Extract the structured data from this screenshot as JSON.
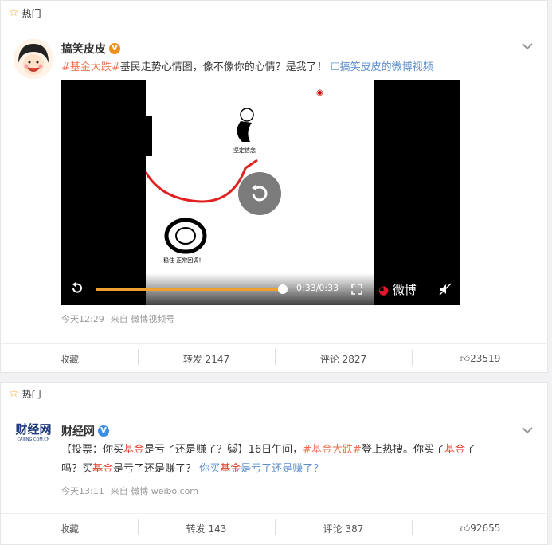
{
  "feed": [
    {
      "hot_label": "热门",
      "user": {
        "name": "搞笑皮皮",
        "badge": "V"
      },
      "text": {
        "topic": "#基金大跌#",
        "body": "基民走势心情图，像不像你的心情？是我了！",
        "link_prefix": "☐",
        "link": "搞笑皮皮的微博视频"
      },
      "video": {
        "time": "0:33/0:33",
        "watermark": "微博",
        "drawing_label_top": "坚定信念",
        "drawing_label_bottom": "稳住 正常回调！",
        "progress": 1.0
      },
      "meta": {
        "time": "今天12:29",
        "source": "来自 微博视频号"
      },
      "actions": {
        "fav": "收藏",
        "repost": "转发 2147",
        "comment": "评论 2827",
        "like": "23519"
      }
    },
    {
      "hot_label": "热门",
      "user": {
        "name": "财经网",
        "badge": "V",
        "logo_text": "财经网",
        "logo_sub": "CAIJING.COM.CN"
      },
      "text": {
        "p1": "【投票：你买",
        "kw1": "基金",
        "p2": "是亏了还是赚了？",
        "emoji": "😺",
        "p3": "】16日午间，",
        "topic": "#基金大跌#",
        "p4": "登上热搜。你买了",
        "kw2": "基金",
        "p5": "了",
        "line2a": "吗？买",
        "kw3": "基金",
        "line2b": "是亏了还是赚了？",
        "link_a": "你买",
        "kw4": "基金",
        "link_b": "是亏了还是赚了？"
      },
      "meta": {
        "time": "今天13:11",
        "source": "来自 微博 weibo.com"
      },
      "actions": {
        "fav": "收藏",
        "repost": "转发 143",
        "comment": "评论 387",
        "like": "92655"
      }
    }
  ],
  "colors": {
    "topic": "#eb7350",
    "link": "#5d8fce",
    "keyword": "#e33d2b",
    "progress": "#f0a030",
    "verified": "#f0901a",
    "verified_blue": "#3a8ee6"
  },
  "icons": [
    "star-icon",
    "chevron-down-icon",
    "replay-icon",
    "fullscreen-icon",
    "weibo-logo-icon",
    "mute-icon",
    "thumb-up-icon"
  ]
}
